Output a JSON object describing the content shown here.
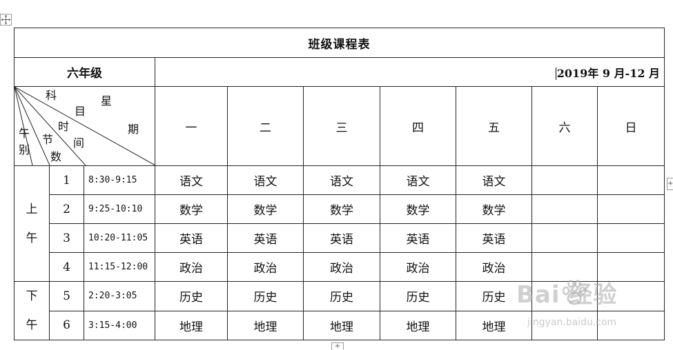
{
  "title": "班级课程表",
  "grade": "六年级",
  "date_range": "2019年 9 月-12 月",
  "header_diagonal": {
    "star_period": [
      "星",
      "期"
    ],
    "subject": [
      "科",
      "目"
    ],
    "lesson_time": [
      "时",
      "间"
    ],
    "section_count": [
      "节",
      "数"
    ],
    "noon_group": [
      "午",
      "别"
    ]
  },
  "days": [
    "一",
    "二",
    "三",
    "四",
    "五",
    "六",
    "日"
  ],
  "sessions": [
    {
      "label": [
        "上",
        "午"
      ]
    },
    {
      "label": [
        "下",
        "午"
      ]
    }
  ],
  "periods": [
    {
      "num": "1",
      "time": "8:30-9:15",
      "subjects": [
        "语文",
        "语文",
        "语文",
        "语文",
        "语文",
        "",
        ""
      ]
    },
    {
      "num": "2",
      "time": "9:25-10:10",
      "subjects": [
        "数学",
        "数学",
        "数学",
        "数学",
        "数学",
        "",
        ""
      ]
    },
    {
      "num": "3",
      "time": "10:20-11:05",
      "subjects": [
        "英语",
        "英语",
        "英语",
        "英语",
        "英语",
        "",
        ""
      ]
    },
    {
      "num": "4",
      "time": "11:15-12:00",
      "subjects": [
        "政治",
        "政治",
        "政治",
        "政治",
        "政治",
        "",
        ""
      ]
    },
    {
      "num": "5",
      "time": "2:20-3:05",
      "subjects": [
        "历史",
        "历史",
        "历史",
        "历史",
        "历史",
        "",
        ""
      ]
    },
    {
      "num": "6",
      "time": "3:15-4:00",
      "subjects": [
        "地理",
        "地理",
        "地理",
        "地理",
        "地理",
        "",
        ""
      ]
    }
  ],
  "watermark": {
    "logo": "Bai  经验",
    "url": "jingyan.baidu.com"
  },
  "handles": {
    "add_row": "+",
    "add_col": "+"
  },
  "icons": {
    "move": "move-arrows-icon"
  }
}
